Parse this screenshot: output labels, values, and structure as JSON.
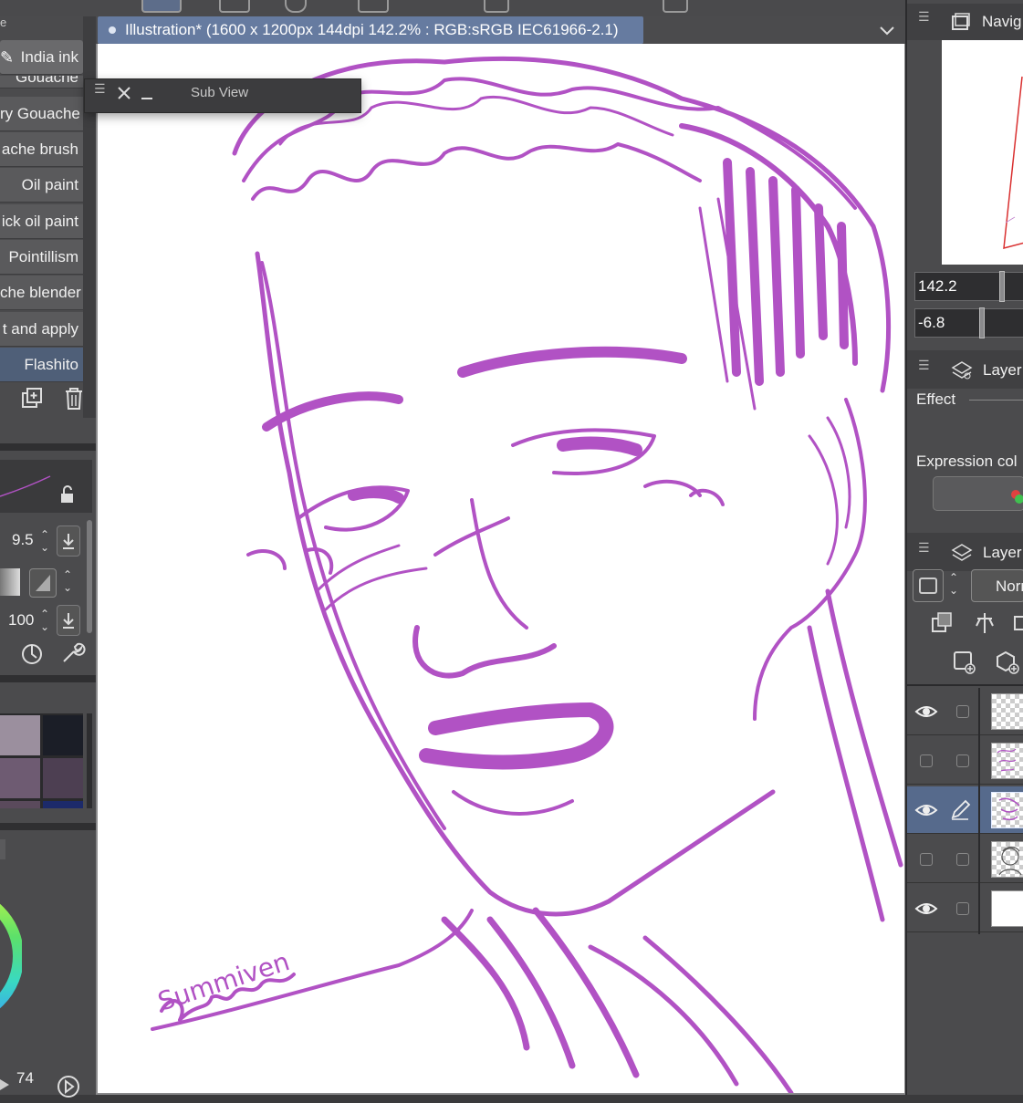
{
  "document": {
    "tab_title": "Illustration* (1600 x 1200px 144dpi 142.2% : RGB:sRGB IEC61966-2.1)"
  },
  "subview": {
    "title": "Sub View"
  },
  "brush_panel": {
    "top_label": "e",
    "items": [
      {
        "label": "India ink",
        "selected": false
      },
      {
        "label": "Gouache",
        "selected": false
      },
      {
        "label": "ry Gouache",
        "selected": false
      },
      {
        "label": "ache brush",
        "selected": false
      },
      {
        "label": "Oil paint",
        "selected": false
      },
      {
        "label": "ick oil paint",
        "selected": false
      },
      {
        "label": "Pointillism",
        "selected": false
      },
      {
        "label": "che blender",
        "selected": false
      },
      {
        "label": "t and apply",
        "selected": false
      },
      {
        "label": "Flashito",
        "selected": true
      }
    ]
  },
  "tool_property": {
    "brush_size": "9.5",
    "opacity": "100"
  },
  "color_palette": {
    "swatches": [
      "#9b8f9e",
      "#1b1e27",
      "#6e5b72",
      "#4d3f52",
      "#5a4a5c",
      "#1c2a6a"
    ]
  },
  "color_wheel": {
    "value": "74"
  },
  "navigator": {
    "title": "Navig",
    "zoom": "142.2",
    "rotation": "-6.8"
  },
  "layer_property": {
    "title": "Layer",
    "effect_label": "Effect",
    "expression_label": "Expression col"
  },
  "layer_panel": {
    "title": "Layer",
    "blend_mode": "Norr",
    "layers": [
      {
        "visible": true,
        "editing": false,
        "thumb": "transparent",
        "selected": false
      },
      {
        "visible": false,
        "editing": false,
        "thumb": "sketch",
        "selected": false
      },
      {
        "visible": true,
        "editing": true,
        "thumb": "sketch",
        "selected": true
      },
      {
        "visible": false,
        "editing": false,
        "thumb": "lineart",
        "selected": false
      },
      {
        "visible": true,
        "editing": false,
        "thumb": "white",
        "selected": false
      }
    ]
  },
  "artwork": {
    "signature": "Summiven",
    "stroke_color": "#b152c4"
  }
}
